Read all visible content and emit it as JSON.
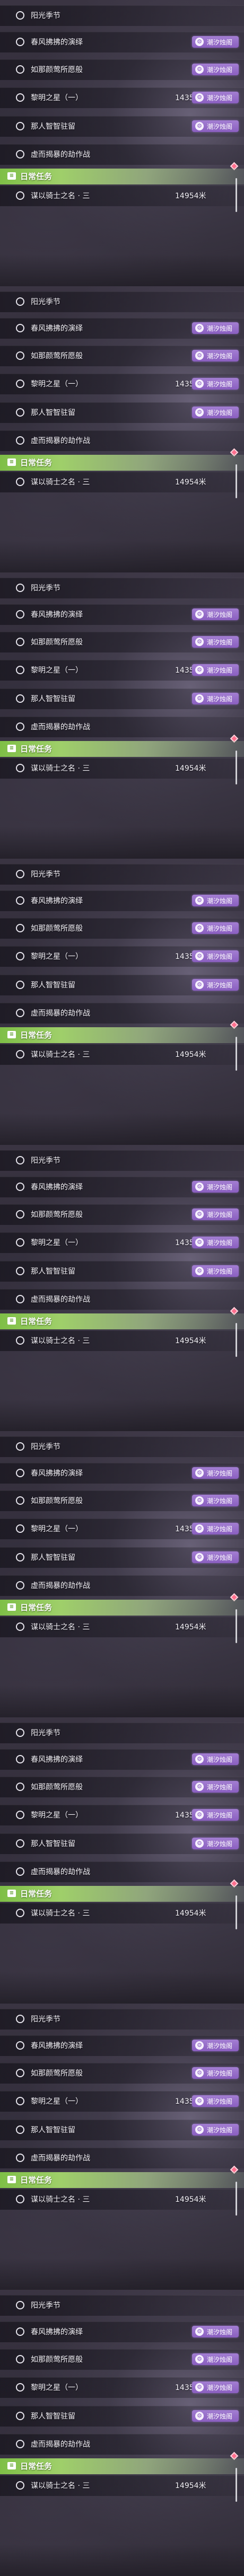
{
  "badge": {
    "label": "潮汐烛阁",
    "icon_name": "gear-icon",
    "color": "#8a5fc0"
  },
  "daily_header": {
    "label": "日常任务",
    "icon_name": "book-icon",
    "color": "#8fc65a"
  },
  "panels": [
    {
      "tasks": [
        {
          "name": "阳光季节",
          "distance": "",
          "badge": false
        },
        {
          "name": "春风拂拂的演绎",
          "distance": "",
          "badge": true
        },
        {
          "name": "如那颜莺所愿般",
          "distance": "",
          "badge": true
        },
        {
          "name": "黎明之星（一）",
          "distance": "14355米",
          "badge": true
        },
        {
          "name": "那人智智驻留",
          "distance": "",
          "badge": true
        },
        {
          "name": "虚而揭暴的劫作战",
          "distance": "",
          "badge": false
        }
      ],
      "daily": {
        "name": "谋以骑士之名 · 三",
        "distance": "14954米"
      }
    },
    {
      "tasks": [
        {
          "name": "阳光季节",
          "distance": "",
          "badge": false
        },
        {
          "name": "春风拂拂的演绎",
          "distance": "",
          "badge": true
        },
        {
          "name": "如那颜莺所愿般",
          "distance": "",
          "badge": true
        },
        {
          "name": "黎明之星（一）",
          "distance": "14355米",
          "badge": true
        },
        {
          "name": "那人智智驻留",
          "distance": "",
          "badge": true
        },
        {
          "name": "虚而揭暴的劫作战",
          "distance": "",
          "badge": false
        }
      ],
      "daily": {
        "name": "谋以骑士之名 · 三",
        "distance": "14954米"
      }
    },
    {
      "tasks": [
        {
          "name": "阳光季节",
          "distance": "",
          "badge": false
        },
        {
          "name": "春风拂拂的演绎",
          "distance": "",
          "badge": true
        },
        {
          "name": "如那颜莺所愿般",
          "distance": "",
          "badge": true
        },
        {
          "name": "黎明之星（一）",
          "distance": "14355米",
          "badge": true
        },
        {
          "name": "那人智智驻留",
          "distance": "",
          "badge": true
        },
        {
          "name": "虚而揭暴的劫作战",
          "distance": "",
          "badge": false
        }
      ],
      "daily": {
        "name": "谋以骑士之名 · 三",
        "distance": "14954米"
      }
    },
    {
      "tasks": [
        {
          "name": "阳光季节",
          "distance": "",
          "badge": false
        },
        {
          "name": "春风拂拂的演绎",
          "distance": "",
          "badge": true
        },
        {
          "name": "如那颜莺所愿般",
          "distance": "",
          "badge": true
        },
        {
          "name": "黎明之星（一）",
          "distance": "14355米",
          "badge": true
        },
        {
          "name": "那人智智驻留",
          "distance": "",
          "badge": true
        },
        {
          "name": "虚而揭暴的劫作战",
          "distance": "",
          "badge": false
        }
      ],
      "daily": {
        "name": "谋以骑士之名 · 三",
        "distance": "14954米"
      }
    },
    {
      "tasks": [
        {
          "name": "阳光季节",
          "distance": "",
          "badge": false
        },
        {
          "name": "春风拂拂的演绎",
          "distance": "",
          "badge": true
        },
        {
          "name": "如那颜莺所愿般",
          "distance": "",
          "badge": true
        },
        {
          "name": "黎明之星（一）",
          "distance": "14355米",
          "badge": true
        },
        {
          "name": "那人智智驻留",
          "distance": "",
          "badge": true
        },
        {
          "name": "虚而揭暴的劫作战",
          "distance": "",
          "badge": false
        }
      ],
      "daily": {
        "name": "谋以骑士之名 · 三",
        "distance": "14954米"
      }
    },
    {
      "tasks": [
        {
          "name": "阳光季节",
          "distance": "",
          "badge": false
        },
        {
          "name": "春风拂拂的演绎",
          "distance": "",
          "badge": true
        },
        {
          "name": "如那颜莺所愿般",
          "distance": "",
          "badge": true
        },
        {
          "name": "黎明之星（一）",
          "distance": "14355米",
          "badge": true
        },
        {
          "name": "那人智智驻留",
          "distance": "",
          "badge": true
        },
        {
          "name": "虚而揭暴的劫作战",
          "distance": "",
          "badge": false
        }
      ],
      "daily": {
        "name": "谋以骑士之名 · 三",
        "distance": "14954米"
      }
    },
    {
      "tasks": [
        {
          "name": "阳光季节",
          "distance": "",
          "badge": false
        },
        {
          "name": "春风拂拂的演绎",
          "distance": "",
          "badge": true
        },
        {
          "name": "如那颜莺所愿般",
          "distance": "",
          "badge": true
        },
        {
          "name": "黎明之星（一）",
          "distance": "14355米",
          "badge": true
        },
        {
          "name": "那人智智驻留",
          "distance": "",
          "badge": true
        },
        {
          "name": "虚而揭暴的劫作战",
          "distance": "",
          "badge": false
        }
      ],
      "daily": {
        "name": "谋以骑士之名 · 三",
        "distance": "14954米"
      }
    },
    {
      "tasks": [
        {
          "name": "阳光季节",
          "distance": "",
          "badge": false
        },
        {
          "name": "春风拂拂的演绎",
          "distance": "",
          "badge": true
        },
        {
          "name": "如那颜莺所愿般",
          "distance": "",
          "badge": true
        },
        {
          "name": "黎明之星（一）",
          "distance": "14355米",
          "badge": true
        },
        {
          "name": "那人智智驻留",
          "distance": "",
          "badge": true
        },
        {
          "name": "虚而揭暴的劫作战",
          "distance": "",
          "badge": false
        }
      ],
      "daily": {
        "name": "谋以骑士之名 · 三",
        "distance": "14954米"
      }
    },
    {
      "tasks": [
        {
          "name": "阳光季节",
          "distance": "",
          "badge": false
        },
        {
          "name": "春风拂拂的演绎",
          "distance": "",
          "badge": true
        },
        {
          "name": "如那颜莺所愿般",
          "distance": "",
          "badge": true
        },
        {
          "name": "黎明之星（一）",
          "distance": "14355米",
          "badge": true
        },
        {
          "name": "那人智智驻留",
          "distance": "",
          "badge": true
        },
        {
          "name": "虚而揭暴的劫作战",
          "distance": "",
          "badge": false
        }
      ],
      "daily": {
        "name": "谋以骑士之名 · 三",
        "distance": "14954米"
      }
    }
  ]
}
